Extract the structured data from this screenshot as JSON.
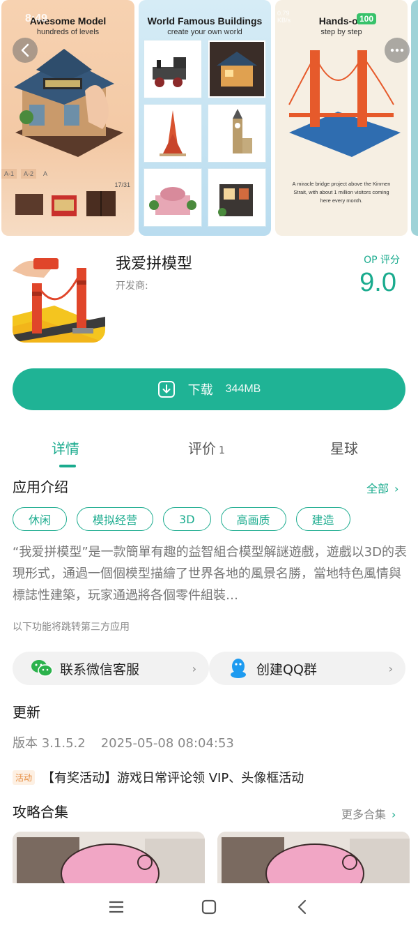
{
  "status_bar": {
    "time": "8:49",
    "network_speed": "0.79",
    "network_unit": "KB/s",
    "battery": "100"
  },
  "carousel": {
    "shots": [
      {
        "title": "Awesome Model",
        "subtitle": "hundreds of levels",
        "progress": "17/31",
        "level_tabs": [
          "A-1",
          "A-2",
          "A"
        ]
      },
      {
        "title": "World Famous Buildings",
        "subtitle": "create your own world"
      },
      {
        "title": "Hands-on",
        "subtitle": "step by step",
        "caption": "A miracle bridge project above the Kinmen Strait, with about 1 million visitors coming here every month."
      }
    ]
  },
  "app": {
    "name": "我爱拼模型",
    "developer_label": "开发商:",
    "score_label": "OP 评分",
    "score": "9.0"
  },
  "download": {
    "label": "下载",
    "size": "344MB"
  },
  "tabs": {
    "details": "详情",
    "reviews": "评价",
    "reviews_count": "1",
    "planet": "星球"
  },
  "intro": {
    "title": "应用介绍",
    "all_link": "全部",
    "tags": [
      "休闲",
      "模拟经营",
      "3D",
      "高画质",
      "建造"
    ],
    "description": "“我爱拼模型”是一款簡單有趣的益智組合模型解謎遊戲，遊戲以3D的表現形式，通過一個個模型描繪了世界各地的風景名勝，當地特色風情與標誌性建築，玩家通過將各個零件組裝…",
    "third_party_note": "以下功能将跳转第三方应用"
  },
  "contacts": {
    "wechat": "联系微信客服",
    "qq": "创建QQ群"
  },
  "update": {
    "title": "更新",
    "version": "版本 3.1.5.2",
    "date": "2025-05-08 08:04:53",
    "activity_badge": "活动",
    "activity_text": "【有奖活动】游戏日常评论领 VIP、头像框活动"
  },
  "guides": {
    "title": "攻略合集",
    "more_link": "更多合集"
  },
  "colors": {
    "accent": "#1aab8e",
    "download": "#1fb395"
  },
  "icons": {
    "back": "back-arrow-icon",
    "more": "more-dots-icon",
    "download": "download-icon",
    "wechat": "wechat-icon",
    "qq": "qq-penguin-icon",
    "nav_menu": "menu-icon",
    "nav_home": "home-icon",
    "nav_back": "back-icon"
  }
}
